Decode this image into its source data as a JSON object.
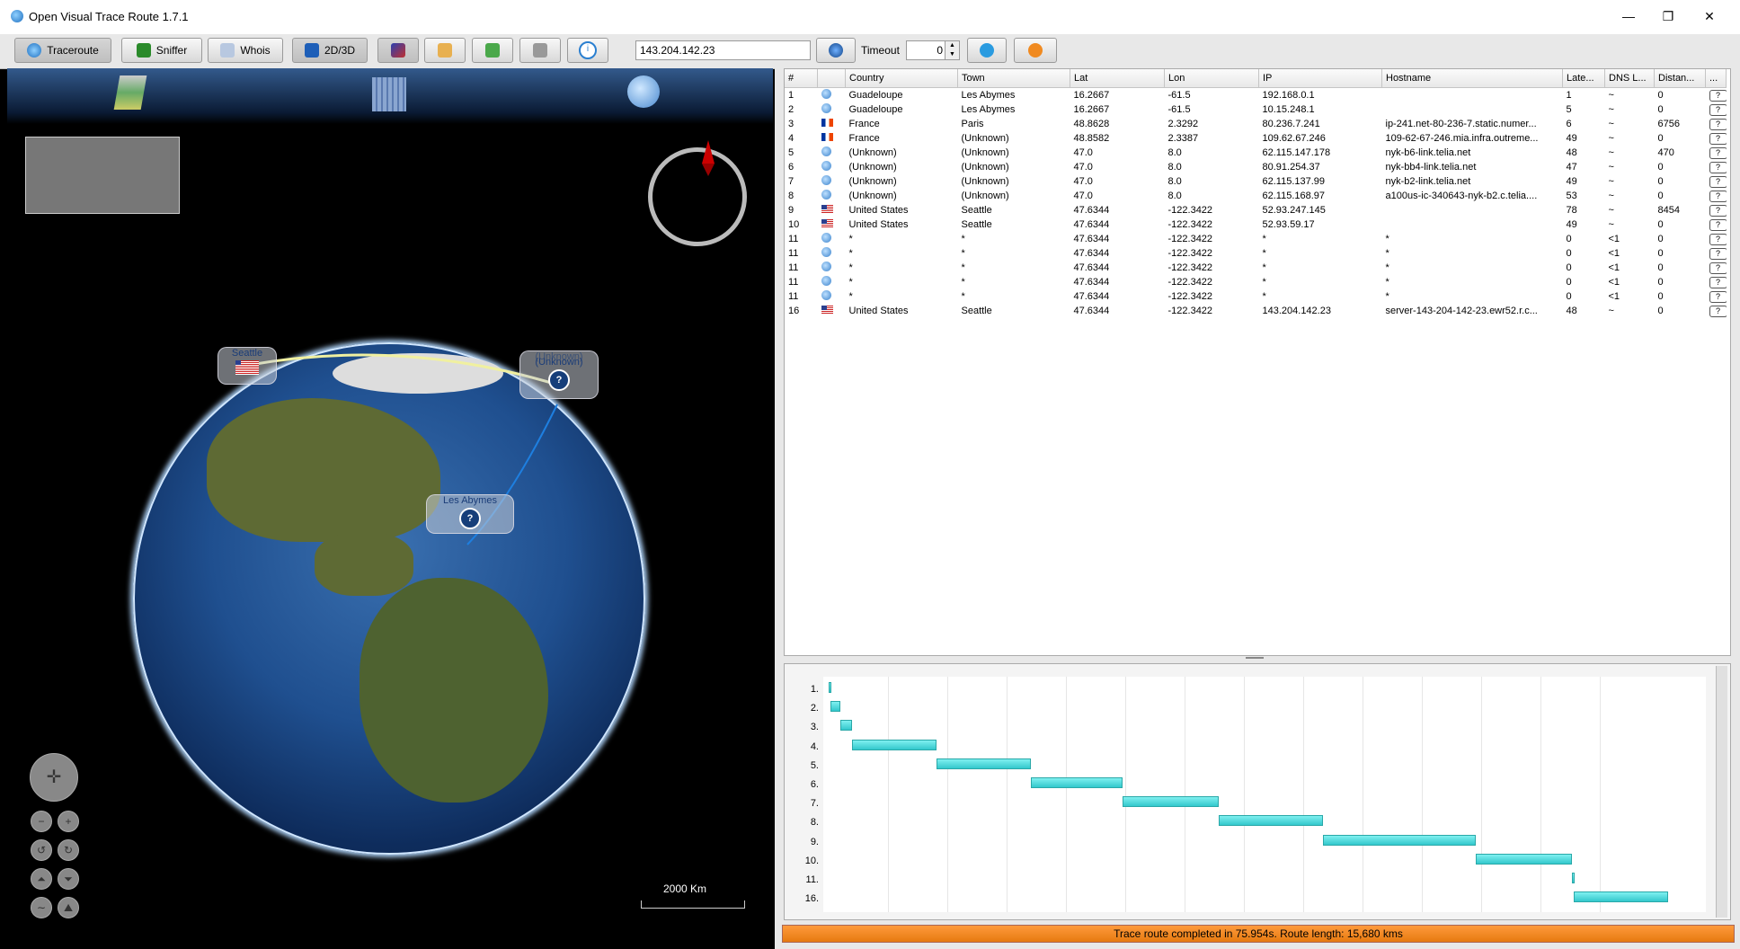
{
  "window": {
    "title": "Open Visual Trace Route 1.7.1",
    "minimize": "—",
    "restore": "❐",
    "close": "✕"
  },
  "toolbar": {
    "traceroute": "Traceroute",
    "sniffer": "Sniffer",
    "whois": "Whois",
    "toggle_3d": "2D/3D",
    "address": "143.204.142.23",
    "timeout_label": "Timeout",
    "timeout_value": "0"
  },
  "map": {
    "labels": {
      "seattle": "Seattle",
      "unknown1": "(Unknown)",
      "unknown2": "(Unknown)",
      "les_abymes": "Les Abymes"
    },
    "scale": "2000 Km",
    "colors": {
      "route": "#1e7fe0"
    }
  },
  "table": {
    "columns": [
      "#",
      "",
      "Country",
      "Town",
      "Lat",
      "Lon",
      "IP",
      "Hostname",
      "Late...",
      "DNS L...",
      "Distan...",
      "..."
    ],
    "rows": [
      {
        "n": "1",
        "flag": "unk",
        "country": "Guadeloupe",
        "town": "Les Abymes",
        "lat": "16.2667",
        "lon": "-61.5",
        "ip": "192.168.0.1",
        "host": "",
        "lat_ms": "1",
        "dns": "~",
        "dist": "0"
      },
      {
        "n": "2",
        "flag": "unk",
        "country": "Guadeloupe",
        "town": "Les Abymes",
        "lat": "16.2667",
        "lon": "-61.5",
        "ip": "10.15.248.1",
        "host": "",
        "lat_ms": "5",
        "dns": "~",
        "dist": "0"
      },
      {
        "n": "3",
        "flag": "fr",
        "country": "France",
        "town": "Paris",
        "lat": "48.8628",
        "lon": "2.3292",
        "ip": "80.236.7.241",
        "host": "ip-241.net-80-236-7.static.numer...",
        "lat_ms": "6",
        "dns": "~",
        "dist": "6756"
      },
      {
        "n": "4",
        "flag": "fr",
        "country": "France",
        "town": "(Unknown)",
        "lat": "48.8582",
        "lon": "2.3387",
        "ip": "109.62.67.246",
        "host": "109-62-67-246.mia.infra.outreme...",
        "lat_ms": "49",
        "dns": "~",
        "dist": "0"
      },
      {
        "n": "5",
        "flag": "unk",
        "country": "(Unknown)",
        "town": "(Unknown)",
        "lat": "47.0",
        "lon": "8.0",
        "ip": "62.115.147.178",
        "host": "nyk-b6-link.telia.net",
        "lat_ms": "48",
        "dns": "~",
        "dist": "470"
      },
      {
        "n": "6",
        "flag": "unk",
        "country": "(Unknown)",
        "town": "(Unknown)",
        "lat": "47.0",
        "lon": "8.0",
        "ip": "80.91.254.37",
        "host": "nyk-bb4-link.telia.net",
        "lat_ms": "47",
        "dns": "~",
        "dist": "0"
      },
      {
        "n": "7",
        "flag": "unk",
        "country": "(Unknown)",
        "town": "(Unknown)",
        "lat": "47.0",
        "lon": "8.0",
        "ip": "62.115.137.99",
        "host": "nyk-b2-link.telia.net",
        "lat_ms": "49",
        "dns": "~",
        "dist": "0"
      },
      {
        "n": "8",
        "flag": "unk",
        "country": "(Unknown)",
        "town": "(Unknown)",
        "lat": "47.0",
        "lon": "8.0",
        "ip": "62.115.168.97",
        "host": "a100us-ic-340643-nyk-b2.c.telia....",
        "lat_ms": "53",
        "dns": "~",
        "dist": "0"
      },
      {
        "n": "9",
        "flag": "us",
        "country": "United States",
        "town": "Seattle",
        "lat": "47.6344",
        "lon": "-122.3422",
        "ip": "52.93.247.145",
        "host": "",
        "lat_ms": "78",
        "dns": "~",
        "dist": "8454"
      },
      {
        "n": "10",
        "flag": "us",
        "country": "United States",
        "town": "Seattle",
        "lat": "47.6344",
        "lon": "-122.3422",
        "ip": "52.93.59.17",
        "host": "",
        "lat_ms": "49",
        "dns": "~",
        "dist": "0"
      },
      {
        "n": "11",
        "flag": "unk",
        "country": "*",
        "town": "*",
        "lat": "47.6344",
        "lon": "-122.3422",
        "ip": "*",
        "host": "*",
        "lat_ms": "0",
        "dns": "<1",
        "dist": "0"
      },
      {
        "n": "11",
        "flag": "unk",
        "country": "*",
        "town": "*",
        "lat": "47.6344",
        "lon": "-122.3422",
        "ip": "*",
        "host": "*",
        "lat_ms": "0",
        "dns": "<1",
        "dist": "0"
      },
      {
        "n": "11",
        "flag": "unk",
        "country": "*",
        "town": "*",
        "lat": "47.6344",
        "lon": "-122.3422",
        "ip": "*",
        "host": "*",
        "lat_ms": "0",
        "dns": "<1",
        "dist": "0"
      },
      {
        "n": "11",
        "flag": "unk",
        "country": "*",
        "town": "*",
        "lat": "47.6344",
        "lon": "-122.3422",
        "ip": "*",
        "host": "*",
        "lat_ms": "0",
        "dns": "<1",
        "dist": "0"
      },
      {
        "n": "11",
        "flag": "unk",
        "country": "*",
        "town": "*",
        "lat": "47.6344",
        "lon": "-122.3422",
        "ip": "*",
        "host": "*",
        "lat_ms": "0",
        "dns": "<1",
        "dist": "0"
      },
      {
        "n": "16",
        "flag": "us",
        "country": "United States",
        "town": "Seattle",
        "lat": "47.6344",
        "lon": "-122.3422",
        "ip": "143.204.142.23",
        "host": "server-143-204-142-23.ewr52.r.c...",
        "lat_ms": "48",
        "dns": "~",
        "dist": "0"
      }
    ]
  },
  "gantt": {
    "labels": [
      "1.",
      "2.",
      "3.",
      "4.",
      "5.",
      "6.",
      "7.",
      "8.",
      "9.",
      "10.",
      "11.",
      "16."
    ],
    "spans": [
      [
        0,
        1
      ],
      [
        1,
        6
      ],
      [
        6,
        12
      ],
      [
        12,
        55
      ],
      [
        55,
        103
      ],
      [
        103,
        150
      ],
      [
        150,
        199
      ],
      [
        199,
        252
      ],
      [
        252,
        330
      ],
      [
        330,
        379
      ],
      [
        379,
        380
      ],
      [
        380,
        428
      ]
    ]
  },
  "status": "Trace route completed in 75.954s. Route length: 15,680 kms"
}
